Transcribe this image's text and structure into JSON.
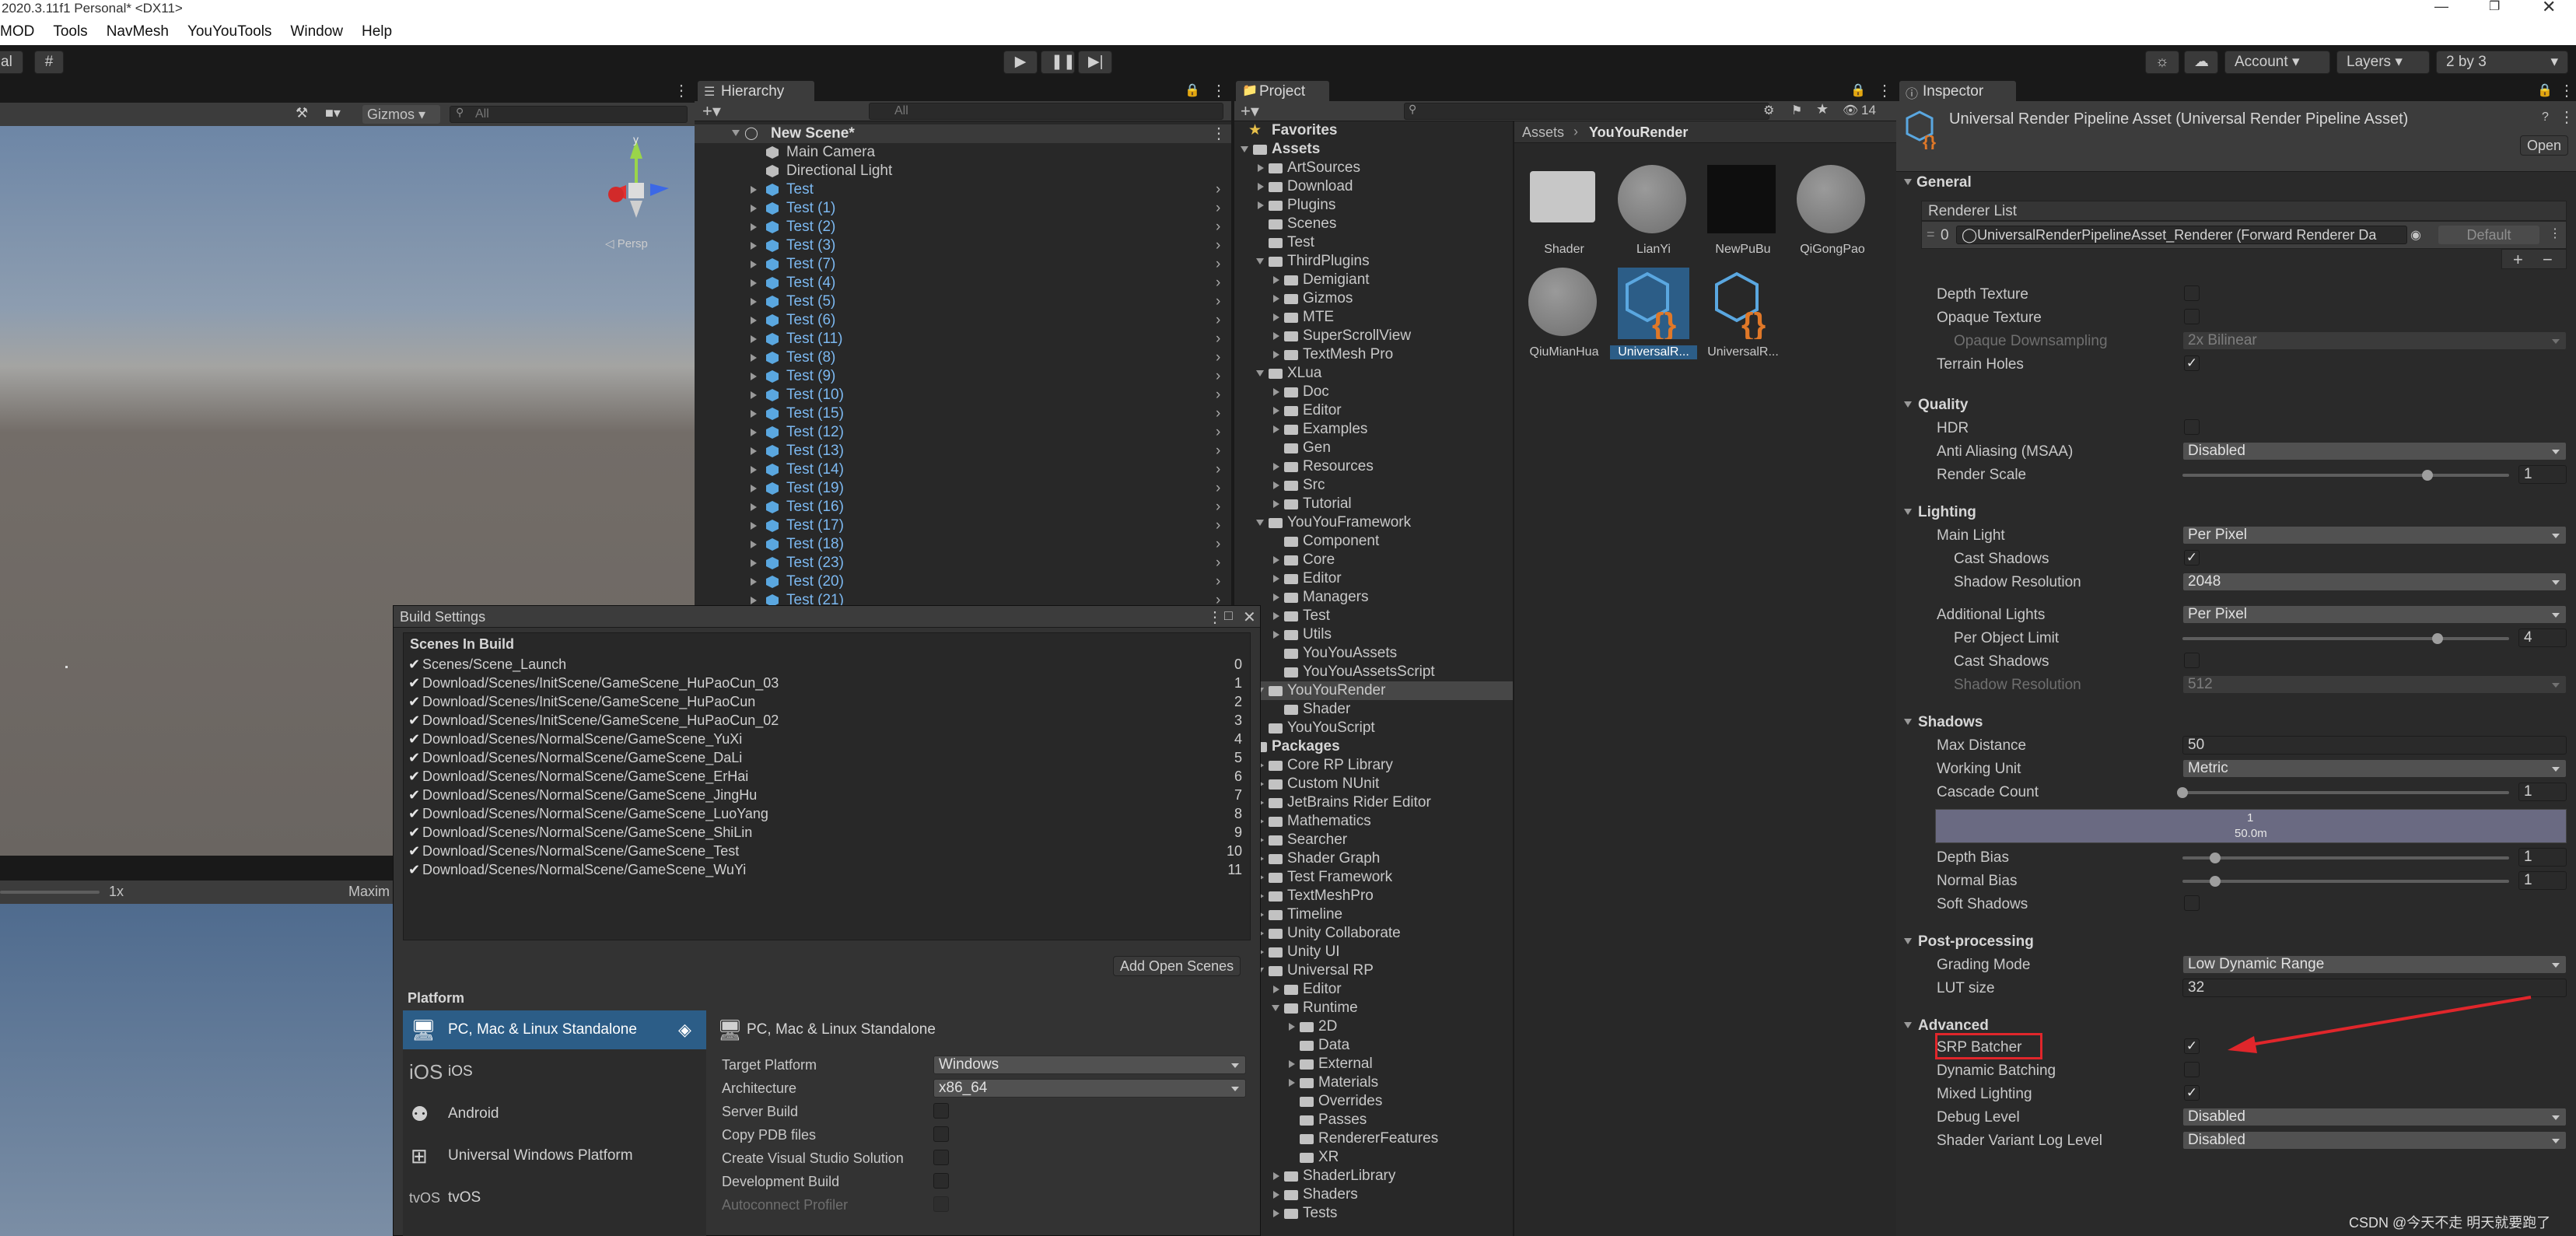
{
  "window": {
    "title": "2020.3.11f1 Personal* <DX11>"
  },
  "menu": [
    "MOD",
    "Tools",
    "NavMesh",
    "YouYouTools",
    "Window",
    "Help"
  ],
  "toolbar": {
    "left_label": "al",
    "account": "Account",
    "layers": "Layers",
    "layout": "2 by 3"
  },
  "scene": {
    "gizmos": "Gizmos",
    "search_placeholder": "All",
    "persp": "◁ Persp",
    "axis_y": "y",
    "game_scale": "1x",
    "game_max": "Maxim"
  },
  "hierarchy": {
    "tab": "Hierarchy",
    "search_placeholder": "All",
    "scene_name": "New Scene*",
    "items": [
      "Main Camera",
      "Directional Light",
      "Test",
      "Test (1)",
      "Test (2)",
      "Test (3)",
      "Test (7)",
      "Test (4)",
      "Test (5)",
      "Test (6)",
      "Test (11)",
      "Test (8)",
      "Test (9)",
      "Test (10)",
      "Test (15)",
      "Test (12)",
      "Test (13)",
      "Test (14)",
      "Test (19)",
      "Test (16)",
      "Test (17)",
      "Test (18)",
      "Test (23)",
      "Test (20)",
      "Test (21)"
    ]
  },
  "project": {
    "tab": "Project",
    "badge": "14",
    "breadcrumb": [
      "Assets",
      "YouYouRender"
    ],
    "tree": [
      {
        "label": "Favorites",
        "depth": 0,
        "kind": "star"
      },
      {
        "label": "Assets",
        "depth": 0,
        "kind": "open"
      },
      {
        "label": "ArtSources",
        "depth": 1,
        "kind": "closed"
      },
      {
        "label": "Download",
        "depth": 1,
        "kind": "closed"
      },
      {
        "label": "Plugins",
        "depth": 1,
        "kind": "closed"
      },
      {
        "label": "Scenes",
        "depth": 1,
        "kind": "leaf"
      },
      {
        "label": "Test",
        "depth": 1,
        "kind": "leaf"
      },
      {
        "label": "ThirdPlugins",
        "depth": 1,
        "kind": "open"
      },
      {
        "label": "Demigiant",
        "depth": 2,
        "kind": "closed"
      },
      {
        "label": "Gizmos",
        "depth": 2,
        "kind": "closed"
      },
      {
        "label": "MTE",
        "depth": 2,
        "kind": "closed"
      },
      {
        "label": "SuperScrollView",
        "depth": 2,
        "kind": "closed"
      },
      {
        "label": "TextMesh Pro",
        "depth": 2,
        "kind": "closed"
      },
      {
        "label": "XLua",
        "depth": 1,
        "kind": "open"
      },
      {
        "label": "Doc",
        "depth": 2,
        "kind": "closed"
      },
      {
        "label": "Editor",
        "depth": 2,
        "kind": "closed"
      },
      {
        "label": "Examples",
        "depth": 2,
        "kind": "closed"
      },
      {
        "label": "Gen",
        "depth": 2,
        "kind": "leaf"
      },
      {
        "label": "Resources",
        "depth": 2,
        "kind": "closed"
      },
      {
        "label": "Src",
        "depth": 2,
        "kind": "closed"
      },
      {
        "label": "Tutorial",
        "depth": 2,
        "kind": "closed"
      },
      {
        "label": "YouYouFramework",
        "depth": 1,
        "kind": "open"
      },
      {
        "label": "Component",
        "depth": 2,
        "kind": "leaf"
      },
      {
        "label": "Core",
        "depth": 2,
        "kind": "closed"
      },
      {
        "label": "Editor",
        "depth": 2,
        "kind": "closed"
      },
      {
        "label": "Managers",
        "depth": 2,
        "kind": "closed"
      },
      {
        "label": "Test",
        "depth": 2,
        "kind": "closed"
      },
      {
        "label": "Utils",
        "depth": 2,
        "kind": "closed"
      },
      {
        "label": "YouYouAssets",
        "depth": 2,
        "kind": "leaf"
      },
      {
        "label": "YouYouAssetsScript",
        "depth": 2,
        "kind": "leaf"
      },
      {
        "label": "YouYouRender",
        "depth": 1,
        "kind": "open",
        "selected": true
      },
      {
        "label": "Shader",
        "depth": 2,
        "kind": "leaf"
      },
      {
        "label": "YouYouScript",
        "depth": 1,
        "kind": "leaf"
      },
      {
        "label": "Packages",
        "depth": 0,
        "kind": "open"
      },
      {
        "label": "Core RP Library",
        "depth": 1,
        "kind": "closed"
      },
      {
        "label": "Custom NUnit",
        "depth": 1,
        "kind": "closed"
      },
      {
        "label": "JetBrains Rider Editor",
        "depth": 1,
        "kind": "closed"
      },
      {
        "label": "Mathematics",
        "depth": 1,
        "kind": "closed"
      },
      {
        "label": "Searcher",
        "depth": 1,
        "kind": "closed"
      },
      {
        "label": "Shader Graph",
        "depth": 1,
        "kind": "closed"
      },
      {
        "label": "Test Framework",
        "depth": 1,
        "kind": "closed"
      },
      {
        "label": "TextMeshPro",
        "depth": 1,
        "kind": "closed"
      },
      {
        "label": "Timeline",
        "depth": 1,
        "kind": "closed"
      },
      {
        "label": "Unity Collaborate",
        "depth": 1,
        "kind": "closed"
      },
      {
        "label": "Unity UI",
        "depth": 1,
        "kind": "closed"
      },
      {
        "label": "Universal RP",
        "depth": 1,
        "kind": "open"
      },
      {
        "label": "Editor",
        "depth": 2,
        "kind": "closed"
      },
      {
        "label": "Runtime",
        "depth": 2,
        "kind": "open"
      },
      {
        "label": "2D",
        "depth": 3,
        "kind": "closed"
      },
      {
        "label": "Data",
        "depth": 3,
        "kind": "leaf"
      },
      {
        "label": "External",
        "depth": 3,
        "kind": "closed"
      },
      {
        "label": "Materials",
        "depth": 3,
        "kind": "closed"
      },
      {
        "label": "Overrides",
        "depth": 3,
        "kind": "leaf"
      },
      {
        "label": "Passes",
        "depth": 3,
        "kind": "leaf"
      },
      {
        "label": "RendererFeatures",
        "depth": 3,
        "kind": "leaf"
      },
      {
        "label": "XR",
        "depth": 3,
        "kind": "leaf"
      },
      {
        "label": "ShaderLibrary",
        "depth": 2,
        "kind": "closed"
      },
      {
        "label": "Shaders",
        "depth": 2,
        "kind": "closed"
      },
      {
        "label": "Tests",
        "depth": 2,
        "kind": "closed"
      }
    ],
    "assets": [
      {
        "name": "Shader",
        "kind": "folder"
      },
      {
        "name": "LianYi",
        "kind": "sphere"
      },
      {
        "name": "NewPuBu",
        "kind": "dark"
      },
      {
        "name": "QiGongPao",
        "kind": "sphere"
      },
      {
        "name": "QiuMianHua",
        "kind": "sphere"
      },
      {
        "name": "UniversalR...",
        "kind": "pipeline",
        "selected": true
      },
      {
        "name": "UniversalR...",
        "kind": "pipeline"
      }
    ]
  },
  "build": {
    "title": "Build Settings",
    "scenes_header": "Scenes In Build",
    "scenes": [
      {
        "path": "Scenes/Scene_Launch",
        "index": "0"
      },
      {
        "path": "Download/Scenes/InitScene/GameScene_HuPaoCun_03",
        "index": "1"
      },
      {
        "path": "Download/Scenes/InitScene/GameScene_HuPaoCun",
        "index": "2"
      },
      {
        "path": "Download/Scenes/InitScene/GameScene_HuPaoCun_02",
        "index": "3"
      },
      {
        "path": "Download/Scenes/NormalScene/GameScene_YuXi",
        "index": "4"
      },
      {
        "path": "Download/Scenes/NormalScene/GameScene_DaLi",
        "index": "5"
      },
      {
        "path": "Download/Scenes/NormalScene/GameScene_ErHai",
        "index": "6"
      },
      {
        "path": "Download/Scenes/NormalScene/GameScene_JingHu",
        "index": "7"
      },
      {
        "path": "Download/Scenes/NormalScene/GameScene_LuoYang",
        "index": "8"
      },
      {
        "path": "Download/Scenes/NormalScene/GameScene_ShiLin",
        "index": "9"
      },
      {
        "path": "Download/Scenes/NormalScene/GameScene_Test",
        "index": "10"
      },
      {
        "path": "Download/Scenes/NormalScene/GameScene_WuYi",
        "index": "11"
      }
    ],
    "add_open_scenes": "Add Open Scenes",
    "platform_header": "Platform",
    "platforms": [
      {
        "label": "PC, Mac & Linux Standalone",
        "icon": "monitor-icon",
        "selected": true
      },
      {
        "label": "iOS",
        "icon": "ios-icon",
        "prefix": "iOS"
      },
      {
        "label": "Android",
        "icon": "android-icon"
      },
      {
        "label": "Universal Windows Platform",
        "icon": "windows-icon"
      },
      {
        "label": "tvOS",
        "icon": "tvos-icon",
        "prefix": "tvOS"
      }
    ],
    "detail_title": "PC, Mac & Linux Standalone",
    "fields": [
      {
        "label": "Target Platform",
        "type": "drop",
        "value": "Windows"
      },
      {
        "label": "Architecture",
        "type": "drop",
        "value": "x86_64"
      },
      {
        "label": "Server Build",
        "type": "check",
        "value": ""
      },
      {
        "label": "Copy PDB files",
        "type": "check",
        "value": ""
      },
      {
        "label": "Create Visual Studio Solution",
        "type": "check",
        "value": ""
      },
      {
        "label": "Development Build",
        "type": "check",
        "value": ""
      },
      {
        "label": "Autoconnect Profiler",
        "type": "check",
        "value": "",
        "disabled": true
      }
    ]
  },
  "inspector": {
    "tab": "Inspector",
    "asset_title": "Universal Render Pipeline Asset (Universal Render Pipeline Asset)",
    "open": "Open",
    "general": "General",
    "renderer_list": "Renderer List",
    "renderer_index": "0",
    "renderer_name": "UniversalRenderPipelineAsset_Renderer (Forward Renderer Da",
    "renderer_default": "Default",
    "depth_texture": "Depth Texture",
    "opaque_texture": "Opaque Texture",
    "opaque_downsampling": "Opaque Downsampling",
    "opaque_downsampling_value": "2x Bilinear",
    "terrain_holes": "Terrain Holes",
    "quality": "Quality",
    "hdr": "HDR",
    "anti_aliasing": "Anti Aliasing (MSAA)",
    "anti_aliasing_value": "Disabled",
    "render_scale": "Render Scale",
    "render_scale_value": "1",
    "lighting": "Lighting",
    "main_light": "Main Light",
    "main_light_value": "Per Pixel",
    "cast_shadows": "Cast Shadows",
    "shadow_resolution": "Shadow Resolution",
    "shadow_resolution_value": "2048",
    "additional_lights": "Additional Lights",
    "additional_lights_value": "Per Pixel",
    "per_object_limit": "Per Object Limit",
    "per_object_limit_value": "4",
    "cast_shadows_2": "Cast Shadows",
    "shadow_resolution_2": "Shadow Resolution",
    "shadow_resolution_2_value": "512",
    "shadows": "Shadows",
    "max_distance": "Max Distance",
    "max_distance_value": "50",
    "working_unit": "Working Unit",
    "working_unit_value": "Metric",
    "cascade_count": "Cascade Count",
    "cascade_count_value": "1",
    "cascade_bar_top": "1",
    "cascade_bar_bottom": "50.0m",
    "depth_bias": "Depth Bias",
    "depth_bias_value": "1",
    "normal_bias": "Normal Bias",
    "normal_bias_value": "1",
    "soft_shadows": "Soft Shadows",
    "post_processing": "Post-processing",
    "grading_mode": "Grading Mode",
    "grading_mode_value": "Low Dynamic Range",
    "lut_size": "LUT size",
    "lut_size_value": "32",
    "advanced": "Advanced",
    "srp_batcher": "SRP Batcher",
    "dynamic_batching": "Dynamic Batching",
    "mixed_lighting": "Mixed Lighting",
    "debug_level": "Debug Level",
    "debug_level_value": "Disabled",
    "shader_variant": "Shader Variant Log Level",
    "shader_variant_value": "Disabled",
    "checks": {
      "depth_texture": false,
      "opaque_texture": false,
      "terrain_holes": true,
      "hdr": false,
      "cast_shadows": true,
      "cast_shadows_2": false,
      "soft_shadows": false,
      "srp_batcher": true,
      "dynamic_batching": false,
      "mixed_lighting": true
    }
  },
  "annotation": {
    "highlight_color": "#e0262b"
  },
  "watermark": "CSDN @今天不走 明天就要跑了"
}
